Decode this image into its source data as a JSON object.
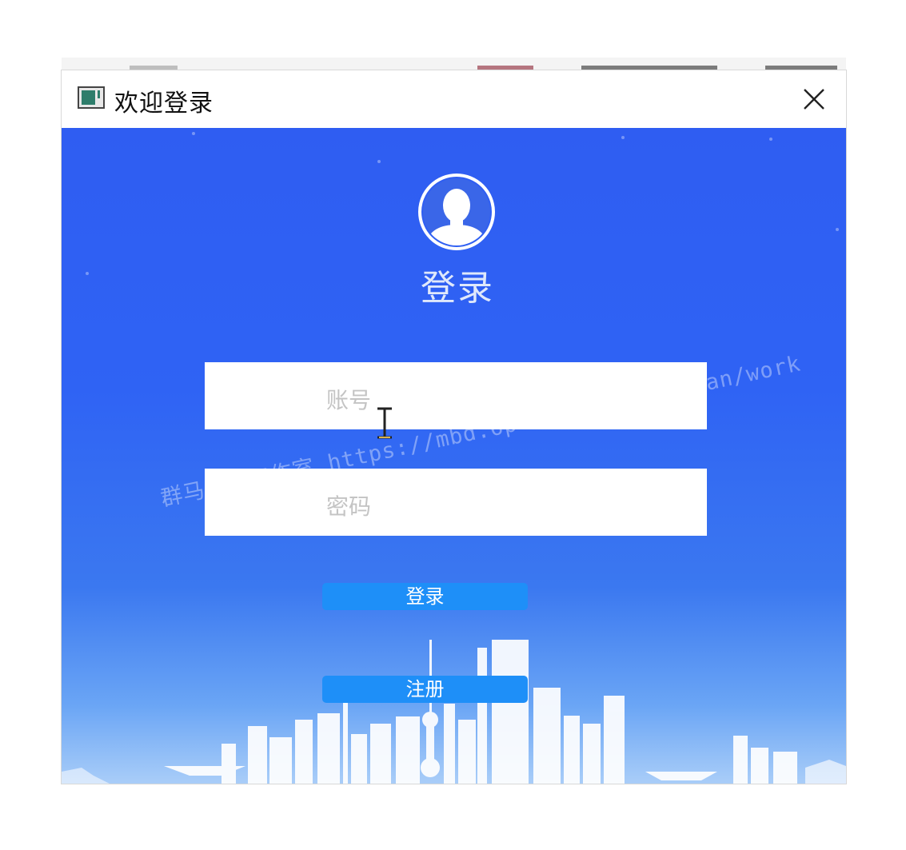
{
  "window": {
    "title": "欢迎登录",
    "icon": "app-window-icon",
    "close_icon": "close-icon"
  },
  "login": {
    "avatar_icon": "user-avatar-icon",
    "heading": "登录",
    "account_placeholder": "账号",
    "password_placeholder": "密码",
    "login_button": "登录",
    "register_button": "注册"
  },
  "watermark": "群马视觉工作室 https://mbd.6pen.art/o/qunshan/work",
  "colors": {
    "background_top": "#2f5df2",
    "background_bottom": "#a9cdf8",
    "button": "#1e8ff8",
    "field": "#ffffff"
  }
}
